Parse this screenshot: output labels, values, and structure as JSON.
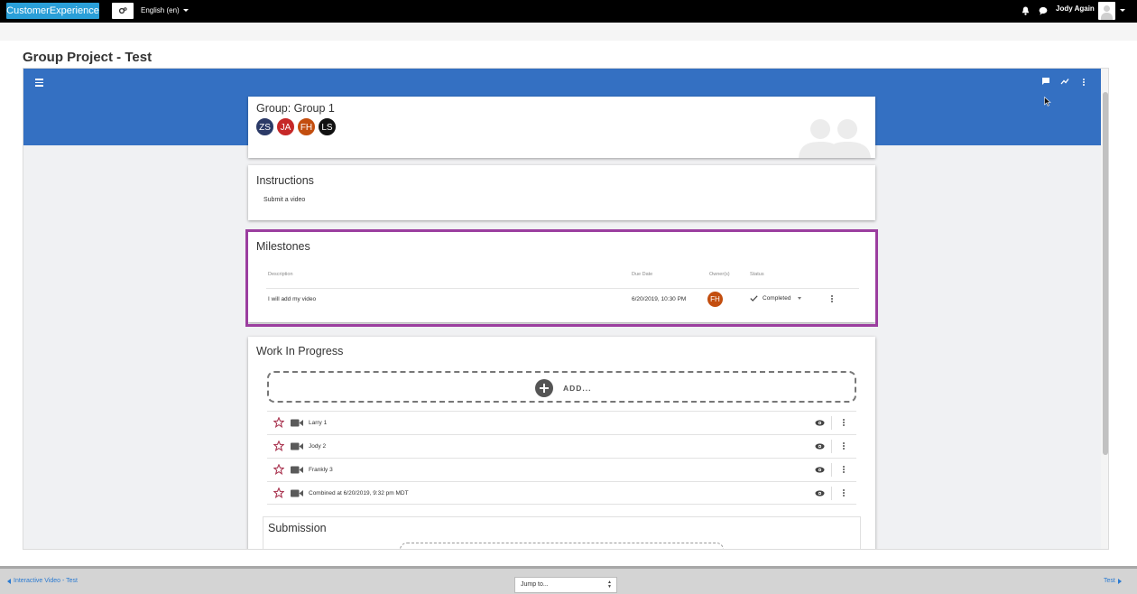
{
  "topbar": {
    "brand": "CustomerExperience",
    "language": "English (en)",
    "username": "Jody Again"
  },
  "page": {
    "title": "Group Project - Test"
  },
  "group": {
    "title": "Group: Group 1",
    "members": [
      {
        "initials": "ZS",
        "color": "#2b3a67"
      },
      {
        "initials": "JA",
        "color": "#c62828"
      },
      {
        "initials": "FH",
        "color": "#c34e0f"
      },
      {
        "initials": "LS",
        "color": "#111111"
      }
    ]
  },
  "instructions": {
    "title": "Instructions",
    "text": "Submit a video"
  },
  "milestones": {
    "title": "Milestones",
    "headers": {
      "description": "Description",
      "due_date": "Due Date",
      "owners": "Owner(s)",
      "status": "Status"
    },
    "rows": [
      {
        "description": "I will add my video",
        "due_date": "6/20/2019, 10:30 PM",
        "owner": "FH",
        "status": "Completed"
      }
    ]
  },
  "work_in_progress": {
    "title": "Work In Progress",
    "add_label": "ADD...",
    "items": [
      {
        "label": "Larry 1"
      },
      {
        "label": "Jody 2"
      },
      {
        "label": "Frankly 3"
      },
      {
        "label": "Combined at 6/20/2019, 9:32 pm MDT"
      }
    ]
  },
  "submission": {
    "title": "Submission"
  },
  "footer": {
    "prev": "Interactive Video - Test",
    "jump": "Jump to...",
    "next": "Test"
  },
  "colors": {
    "brand_button": "#2a9fd8",
    "header_band": "#3470c2",
    "highlight": "#9b3e9f",
    "star": "#a9334f",
    "link": "#2a7ad1"
  }
}
